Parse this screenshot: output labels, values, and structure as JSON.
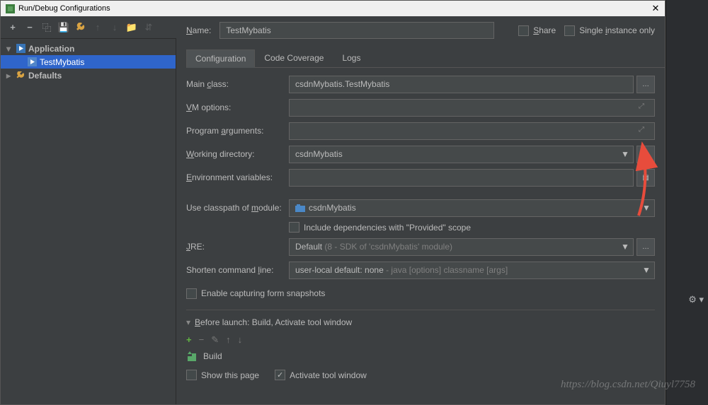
{
  "titlebar": {
    "title": "Run/Debug Configurations"
  },
  "tree": {
    "app_node": "Application",
    "app_item": "TestMybatis",
    "defaults": "Defaults"
  },
  "header": {
    "name_label": "Name:",
    "name_value": "TestMybatis",
    "share_label": "Share",
    "single_instance_label": "Single instance only"
  },
  "tabs": {
    "config": "Configuration",
    "coverage": "Code Coverage",
    "logs": "Logs"
  },
  "form": {
    "main_class_label": "Main class:",
    "main_class_value": "csdnMybatis.TestMybatis",
    "vm_options_label": "VM options:",
    "program_args_label": "Program arguments:",
    "working_dir_label": "Working directory:",
    "working_dir_value": "csdnMybatis",
    "env_vars_label": "Environment variables:",
    "classpath_label": "Use classpath of module:",
    "classpath_value": "csdnMybatis",
    "include_provided": "Include dependencies with \"Provided\" scope",
    "jre_label": "JRE:",
    "jre_value": "Default",
    "jre_hint": "(8 - SDK of 'csdnMybatis' module)",
    "shorten_label": "Shorten command line:",
    "shorten_value": "user-local default: none",
    "shorten_hint": "- java [options] classname [args]",
    "enable_snapshots": "Enable capturing form snapshots"
  },
  "before_launch": {
    "title": "Before launch: Build, Activate tool window",
    "build": "Build",
    "show_page": "Show this page",
    "activate_window": "Activate tool window"
  },
  "watermark": "https://blog.csdn.net/Qiuyl7758"
}
